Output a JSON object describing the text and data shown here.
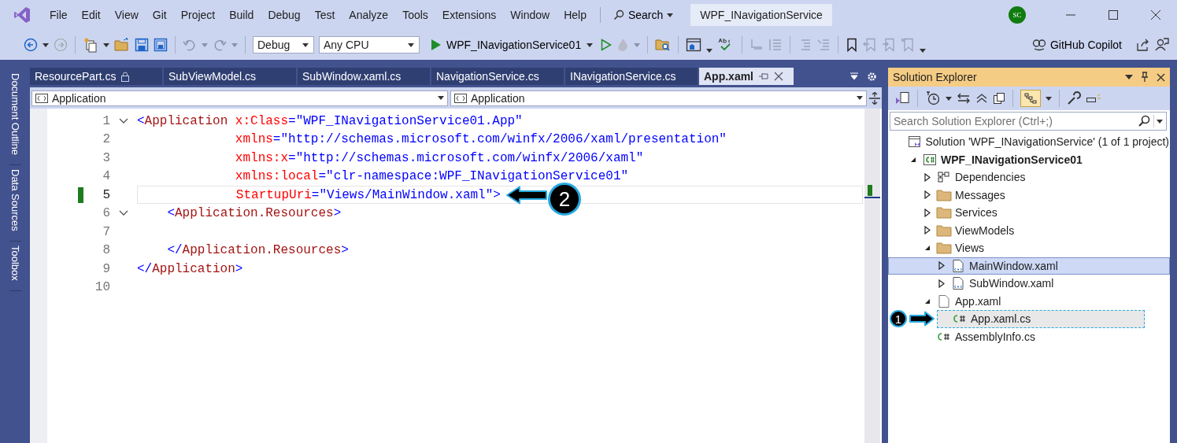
{
  "menu": [
    "File",
    "Edit",
    "View",
    "Git",
    "Project",
    "Build",
    "Debug",
    "Test",
    "Analyze",
    "Tools",
    "Extensions",
    "Window",
    "Help"
  ],
  "search": "Search",
  "solution_name": "WPF_INavigationService",
  "avatar": "SC",
  "toolbar": {
    "configuration": "Debug",
    "platform": "Any CPU",
    "start_target": "WPF_INavigationService01",
    "copilot": "GitHub Copilot"
  },
  "side_tabs": [
    "Document Outline",
    "Data Sources",
    "Toolbox"
  ],
  "tabs": [
    {
      "label": "ResourcePart.cs",
      "selected": false,
      "locked": true
    },
    {
      "label": "SubViewModel.cs",
      "selected": false,
      "locked": false
    },
    {
      "label": "SubWindow.xaml.cs",
      "selected": false,
      "locked": false
    },
    {
      "label": "NavigationService.cs",
      "selected": false,
      "locked": false
    },
    {
      "label": "INavigationService.cs",
      "selected": false,
      "locked": false
    },
    {
      "label": "App.xaml",
      "selected": true,
      "locked": false
    }
  ],
  "navigation_bar": [
    "Application",
    "Application"
  ],
  "code_lines": [
    {
      "number": "1",
      "fold": true,
      "current": false,
      "modified": false,
      "tokens": [
        {
          "kind": "punct",
          "text": "<"
        },
        {
          "kind": "tag",
          "text": "Application"
        },
        {
          "kind": "attr",
          "text": " x:Class"
        },
        {
          "kind": "punct",
          "text": "="
        },
        {
          "kind": "value",
          "text": "\"WPF_INavigationService01.App\""
        }
      ]
    },
    {
      "number": "2",
      "fold": false,
      "current": false,
      "modified": false,
      "tokens": [
        {
          "kind": "attr",
          "text": "             xmlns"
        },
        {
          "kind": "punct",
          "text": "="
        },
        {
          "kind": "value",
          "text": "\"http://schemas.microsoft.com/winfx/2006/xaml/presentation\""
        }
      ]
    },
    {
      "number": "3",
      "fold": false,
      "current": false,
      "modified": false,
      "tokens": [
        {
          "kind": "attr",
          "text": "             xmlns:x"
        },
        {
          "kind": "punct",
          "text": "="
        },
        {
          "kind": "value",
          "text": "\"http://schemas.microsoft.com/winfx/2006/xaml\""
        }
      ]
    },
    {
      "number": "4",
      "fold": false,
      "current": false,
      "modified": false,
      "tokens": [
        {
          "kind": "attr",
          "text": "             xmlns:local"
        },
        {
          "kind": "punct",
          "text": "="
        },
        {
          "kind": "value",
          "text": "\"clr-namespace:WPF_INavigationService01\""
        }
      ]
    },
    {
      "number": "5",
      "fold": false,
      "current": true,
      "modified": true,
      "callout": "2",
      "tokens": [
        {
          "kind": "attr",
          "text": "             StartupUri"
        },
        {
          "kind": "punct",
          "text": "="
        },
        {
          "kind": "value",
          "text": "\"Views/MainWindow.xaml\""
        },
        {
          "kind": "punct",
          "text": ">"
        }
      ]
    },
    {
      "number": "6",
      "fold": true,
      "current": false,
      "modified": false,
      "tokens": [
        {
          "kind": "punct",
          "text": "    <"
        },
        {
          "kind": "tag",
          "text": "Application.Resources"
        },
        {
          "kind": "punct",
          "text": ">"
        }
      ]
    },
    {
      "number": "7",
      "fold": false,
      "current": false,
      "modified": false
    },
    {
      "number": "8",
      "fold": false,
      "current": false,
      "modified": false,
      "tokens": [
        {
          "kind": "punct",
          "text": "    </"
        },
        {
          "kind": "tag",
          "text": "Application.Resources"
        },
        {
          "kind": "punct",
          "text": ">"
        }
      ]
    },
    {
      "number": "9",
      "fold": false,
      "current": false,
      "modified": false,
      "tokens": [
        {
          "kind": "punct",
          "text": "</"
        },
        {
          "kind": "tag",
          "text": "Application"
        },
        {
          "kind": "punct",
          "text": ">"
        }
      ]
    },
    {
      "number": "10",
      "fold": false,
      "current": false,
      "modified": false
    }
  ],
  "solution_explorer": {
    "title": "Solution Explorer",
    "search_placeholder": "Search Solution Explorer (Ctrl+;)",
    "tree": [
      {
        "label": "Solution 'WPF_INavigationService' (1 of 1 project)",
        "kind": "solution",
        "selected": false,
        "children": [
          {
            "label": "WPF_INavigationService01",
            "kind": "project",
            "selected": false,
            "expanded": true,
            "children": [
              {
                "label": "Dependencies",
                "kind": "dependencies",
                "selected": false,
                "expanded": false
              },
              {
                "label": "Messages",
                "kind": "folder",
                "selected": false,
                "expanded": false
              },
              {
                "label": "Services",
                "kind": "folder",
                "selected": false,
                "expanded": false
              },
              {
                "label": "ViewModels",
                "kind": "folder",
                "selected": false,
                "expanded": false
              },
              {
                "label": "Views",
                "kind": "folder",
                "selected": false,
                "expanded": true,
                "children": [
                  {
                    "label": "MainWindow.xaml",
                    "kind": "xaml",
                    "selected": true,
                    "expanded": false
                  },
                  {
                    "label": "SubWindow.xaml",
                    "kind": "xaml",
                    "selected": false,
                    "expanded": false
                  }
                ]
              },
              {
                "label": "App.xaml",
                "kind": "file",
                "selected": false,
                "expanded": true,
                "children": [
                  {
                    "label": "App.xaml.cs",
                    "kind": "csharp",
                    "selected": false,
                    "callout": "1"
                  }
                ]
              },
              {
                "label": "AssemblyInfo.cs",
                "kind": "csharp",
                "selected": false
              }
            ]
          }
        ]
      }
    ]
  }
}
